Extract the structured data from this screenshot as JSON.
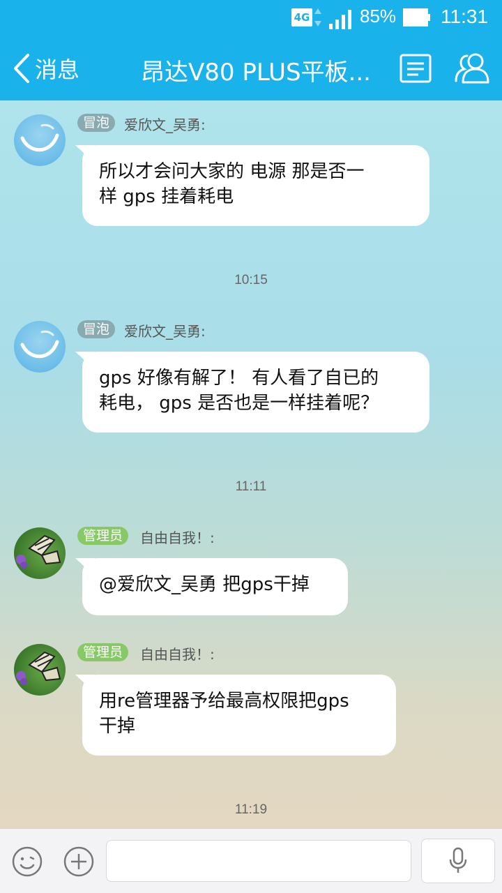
{
  "status_bar": {
    "network": "4G",
    "battery_percent": "85%",
    "time": "11:31"
  },
  "nav_bar": {
    "back_label": "消息",
    "title": "昂达V80 PLUS平板..."
  },
  "messages": [
    {
      "badge": "冒泡",
      "sender": "爱欣文_吴勇:",
      "lines": [
        "所以才会问大家的 电源 那是否一",
        "样 gps 挂着耗电"
      ]
    },
    {
      "timestamp": "10:15"
    },
    {
      "badge": "冒泡",
      "sender": "爱欣文_吴勇:",
      "lines": [
        "gps 好像有解了！ 有人看了自已的",
        "耗电， gps 是否也是一样挂着呢？"
      ]
    },
    {
      "timestamp": "11:11"
    },
    {
      "badge": "管理员",
      "sender": "自由自我！:",
      "lines": [
        "@爱欣文_吴勇 把gps干掉"
      ]
    },
    {
      "badge": "管理员",
      "sender": "自由自我！:",
      "lines": [
        "用re管理器予给最高权限把gps",
        "干掉"
      ]
    },
    {
      "timestamp": "11:19"
    }
  ],
  "input_bar": {
    "placeholder": ""
  },
  "colors": {
    "accent": "#1ab2ea",
    "badge_member": "#8aaab2",
    "badge_admin": "#88c967"
  },
  "icons": {
    "back": "chevron-left-icon",
    "group_info": "document-icon",
    "members": "people-icon",
    "emoji": "smiley-icon",
    "plus": "plus-icon",
    "voice": "microphone-icon"
  }
}
